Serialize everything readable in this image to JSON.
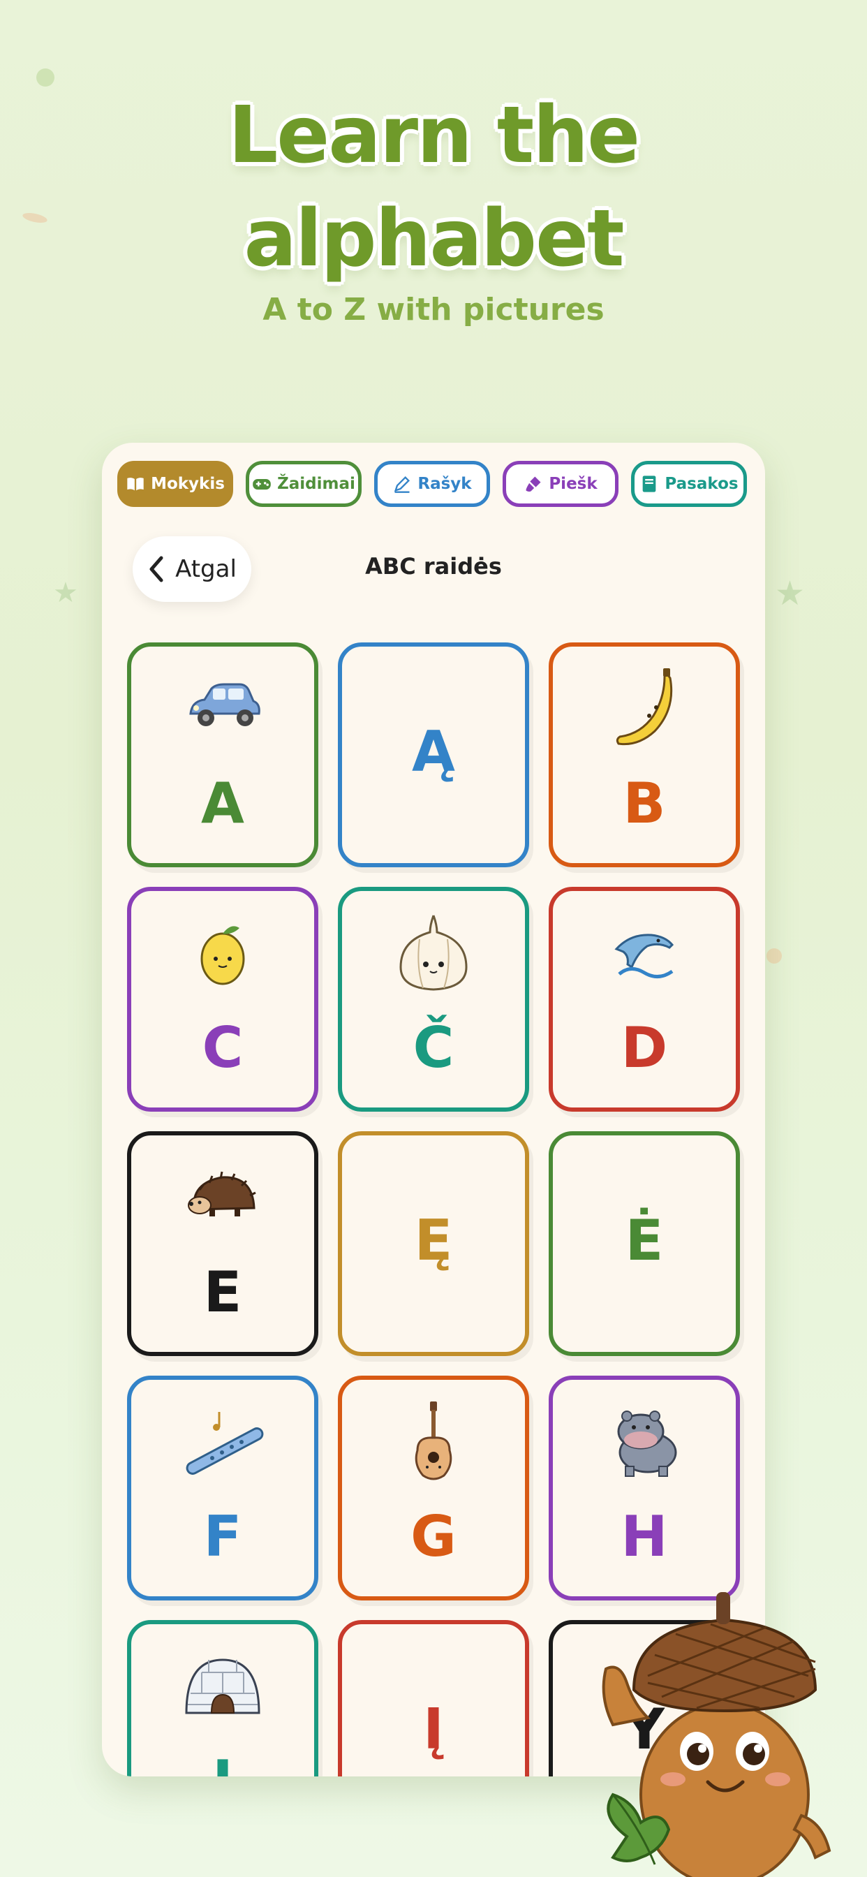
{
  "hero": {
    "title_line1": "Learn the",
    "title_line2": "alphabet",
    "subtitle": "A to Z with pictures"
  },
  "tabs": [
    {
      "label": "Mokykis",
      "icon": "book-icon",
      "color": "#b38a2c",
      "active": true
    },
    {
      "label": "Žaidimai",
      "icon": "gamepad-icon",
      "color": "#4f8f3a",
      "active": false
    },
    {
      "label": "Rašyk",
      "icon": "pencil-icon",
      "color": "#3383c8",
      "active": false
    },
    {
      "label": "Piešk",
      "icon": "brush-icon",
      "color": "#8a3fb8",
      "active": false
    },
    {
      "label": "Pasakos",
      "icon": "storybook-icon",
      "color": "#1a9a8a",
      "active": false
    }
  ],
  "header": {
    "back_label": "Atgal",
    "title": "ABC raidės"
  },
  "cards": [
    {
      "letter": "A",
      "color": "#4a8a35",
      "picture": "car-icon"
    },
    {
      "letter": "Ą",
      "color": "#3383c8",
      "picture": ""
    },
    {
      "letter": "B",
      "color": "#d85a14",
      "picture": "banana-icon"
    },
    {
      "letter": "C",
      "color": "#8a3fb8",
      "picture": "lemon-icon"
    },
    {
      "letter": "Č",
      "color": "#1a9a80",
      "picture": "garlic-icon"
    },
    {
      "letter": "D",
      "color": "#c83a2c",
      "picture": "dolphin-icon"
    },
    {
      "letter": "E",
      "color": "#1a1a1a",
      "picture": "hedgehog-icon"
    },
    {
      "letter": "Ę",
      "color": "#c28e2a",
      "picture": ""
    },
    {
      "letter": "Ė",
      "color": "#4a8a35",
      "picture": ""
    },
    {
      "letter": "F",
      "color": "#3383c8",
      "picture": "flute-icon"
    },
    {
      "letter": "G",
      "color": "#d85a14",
      "picture": "guitar-icon"
    },
    {
      "letter": "H",
      "color": "#8a3fb8",
      "picture": "hippo-icon"
    },
    {
      "letter": "I",
      "color": "#1a9a80",
      "picture": "igloo-icon"
    },
    {
      "letter": "Į",
      "color": "#c83a2c",
      "picture": ""
    },
    {
      "letter": "Y",
      "color": "#1a1a1a",
      "picture": ""
    }
  ]
}
